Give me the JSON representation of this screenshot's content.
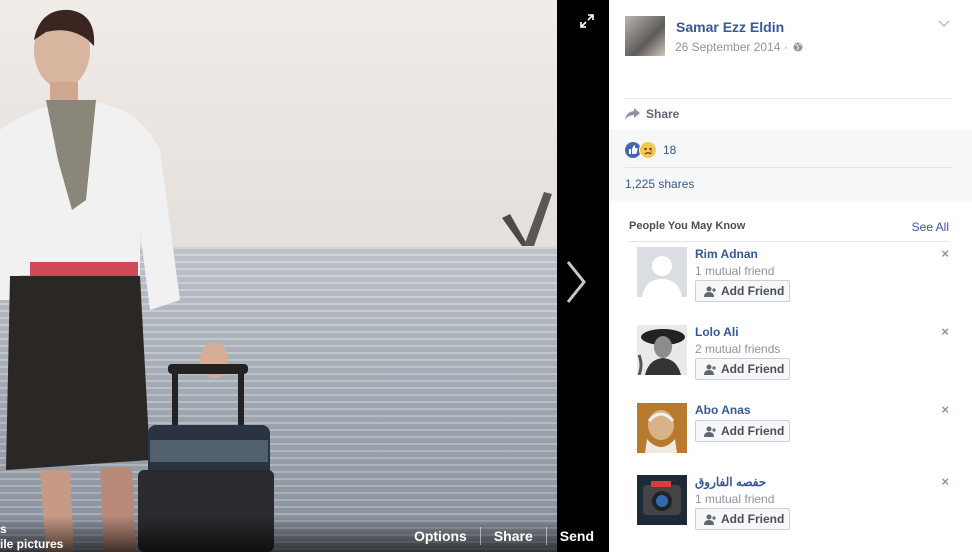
{
  "photo": {
    "label_line1": "s",
    "label_line2": "ile pictures",
    "actions": [
      "Options",
      "Share",
      "Send"
    ]
  },
  "post": {
    "author": "Samar Ezz Eldin",
    "date": "26 September 2014 ·",
    "share_label": "Share",
    "reaction_count": "18",
    "shares": "1,225 shares"
  },
  "pymk": {
    "title": "People You May Know",
    "see_all": "See All",
    "add_label": "Add Friend",
    "people": [
      {
        "name": "Rim Adnan",
        "mutual": "1 mutual friend"
      },
      {
        "name": "Lolo Ali",
        "mutual": "2 mutual friends"
      },
      {
        "name": "Abo Anas",
        "mutual": ""
      },
      {
        "name": "حفصه الفاروق",
        "mutual": "1 mutual friend"
      }
    ],
    "close_glyph": "×"
  },
  "colors": {
    "link": "#365899",
    "like": "#4267b2",
    "sad": "#f7c84b"
  }
}
